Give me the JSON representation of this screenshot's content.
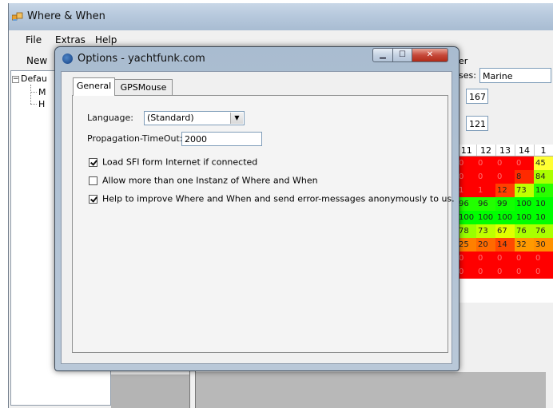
{
  "app": {
    "title": "Where & When",
    "menu": [
      "File",
      "Extras",
      "Help"
    ],
    "toolbar_new": "New",
    "tree": {
      "root_label": "Defau",
      "children": [
        "M",
        "H"
      ]
    },
    "right_panel": {
      "label_fragment": "er",
      "classes_label": "ses:",
      "classes_value": "Marine",
      "value1": "167",
      "value2": "121"
    },
    "grid": {
      "headers": [
        "11",
        "12",
        "13",
        "14",
        "1"
      ],
      "rows": [
        {
          "cells": [
            "0",
            "0",
            "0",
            "0",
            "45"
          ],
          "colors": [
            "#ff0000",
            "#ff0000",
            "#ff0000",
            "#ff0000",
            "#ffff33"
          ]
        },
        {
          "cells": [
            "0",
            "0",
            "0",
            "8",
            "84"
          ],
          "colors": [
            "#ff0000",
            "#ff0000",
            "#ff0000",
            "#ff2a00",
            "#aaff00"
          ]
        },
        {
          "cells": [
            "1",
            "1",
            "12",
            "73",
            "10"
          ],
          "colors": [
            "#ff0000",
            "#ff0000",
            "#ff4000",
            "#bfff00",
            "#2aff00"
          ]
        },
        {
          "cells": [
            "96",
            "96",
            "99",
            "100",
            "10"
          ],
          "colors": [
            "#22ff00",
            "#22ff00",
            "#11ff00",
            "#00ff00",
            "#00ff00"
          ]
        },
        {
          "cells": [
            "100",
            "100",
            "100",
            "100",
            "10"
          ],
          "colors": [
            "#00ff00",
            "#00ff00",
            "#00ff00",
            "#00ff00",
            "#00ff00"
          ]
        },
        {
          "cells": [
            "78",
            "73",
            "67",
            "76",
            "76"
          ],
          "colors": [
            "#99ff00",
            "#bfff00",
            "#e0ff00",
            "#aaff00",
            "#aaff00"
          ]
        },
        {
          "cells": [
            "25",
            "20",
            "14",
            "32",
            "30"
          ],
          "colors": [
            "#ff8000",
            "#ff6a00",
            "#ff4a00",
            "#ff9a00",
            "#ff9000"
          ]
        },
        {
          "cells": [
            "0",
            "0",
            "0",
            "0",
            "0"
          ],
          "colors": [
            "#ff0000",
            "#ff0000",
            "#ff0000",
            "#ff0000",
            "#ff0000"
          ]
        },
        {
          "cells": [
            "0",
            "0",
            "0",
            "0",
            "0"
          ],
          "colors": [
            "#ff0000",
            "#ff0000",
            "#ff0000",
            "#ff0000",
            "#ff0000"
          ]
        }
      ]
    }
  },
  "dialog": {
    "title": "Options - yachtfunk.com",
    "tabs": [
      "General",
      "GPSMouse"
    ],
    "language_label": "Language:",
    "language_value": "(Standard)",
    "timeout_label": "Propagation-TimeOut:",
    "timeout_value": "2000",
    "checkboxes": [
      {
        "label": "Load SFI form Internet if connected",
        "checked": true
      },
      {
        "label": "Allow more than one Instanz of Where and When",
        "checked": false
      },
      {
        "label": "Help to improve Where and When and send error-messages anonymously to us.",
        "checked": true
      }
    ]
  },
  "icons": {
    "app": "app-window-icon",
    "dialog": "dialog-globe-icon",
    "minimize": "minimize-icon",
    "maximize": "maximize-icon",
    "close": "close-icon",
    "dropdown": "chevron-down-icon"
  }
}
